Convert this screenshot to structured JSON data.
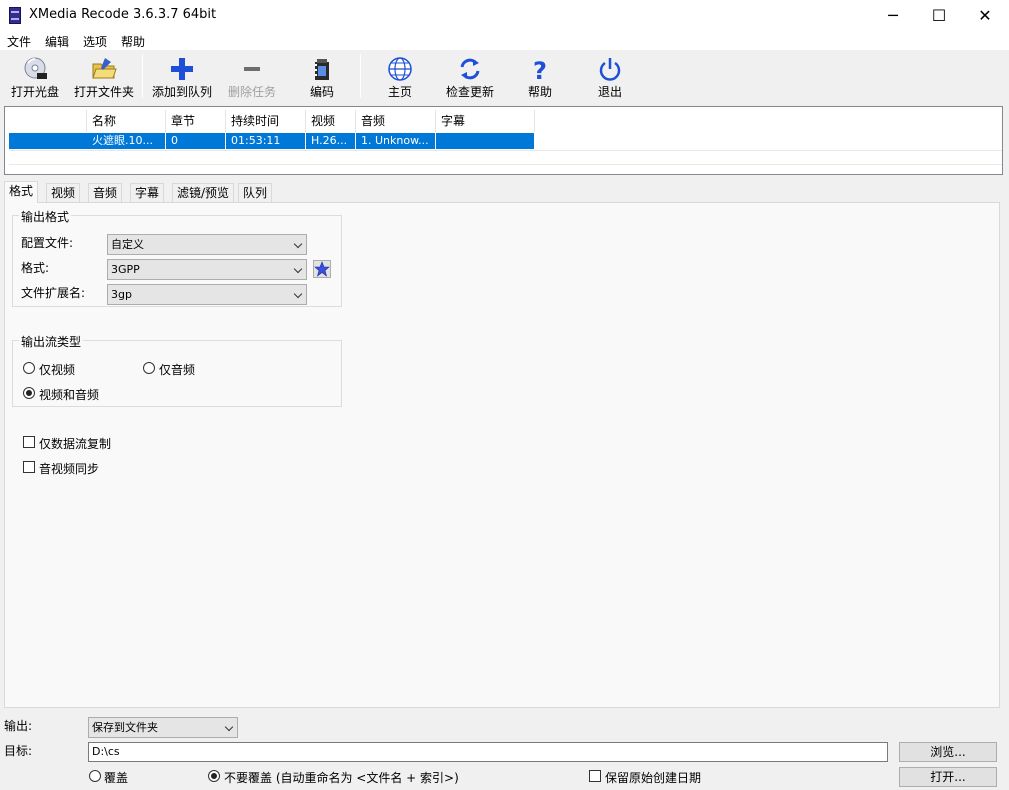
{
  "window": {
    "title": "XMedia Recode 3.6.3.7 64bit",
    "min": "─",
    "max": "☐",
    "close": "✕"
  },
  "menu": [
    "文件",
    "编辑",
    "选项",
    "帮助"
  ],
  "toolbar": {
    "open_disc": "打开光盘",
    "open_folder": "打开文件夹",
    "add_queue": "添加到队列",
    "remove_task": "删除任务",
    "encode": "编码",
    "home": "主页",
    "check_update": "检查更新",
    "help": "帮助",
    "exit": "退出"
  },
  "filelist": {
    "columns": [
      "名称",
      "章节",
      "持续时间",
      "视频",
      "音频",
      "字幕"
    ],
    "rows": [
      {
        "name": "火遮眼.10...",
        "chapter": "0",
        "duration": "01:53:11",
        "video": "H.26...",
        "audio": "1. Unknow...",
        "subtitle": ""
      }
    ]
  },
  "tabs": [
    "格式",
    "视频",
    "音频",
    "字幕",
    "滤镜/预览",
    "队列"
  ],
  "output_format": {
    "title": "输出格式",
    "profile_label": "配置文件:",
    "profile_value": "自定义",
    "format_label": "格式:",
    "format_value": "3GPP",
    "ext_label": "文件扩展名:",
    "ext_value": "3gp"
  },
  "stream_type": {
    "title": "输出流类型",
    "video_only": "仅视频",
    "audio_only": "仅音频",
    "video_audio": "视频和音频",
    "selected": "video_audio"
  },
  "options": {
    "stream_copy": "仅数据流复制",
    "av_sync": "音视频同步"
  },
  "bottom": {
    "output_label": "输出:",
    "output_value": "保存到文件夹",
    "target_label": "目标:",
    "target_value": "D:\\cs",
    "browse": "浏览...",
    "open": "打开...",
    "overwrite": "覆盖",
    "no_overwrite": "不要覆盖 (自动重命名为 <文件名 + 索引>)",
    "keep_date": "保留原始创建日期"
  },
  "colors": {
    "selection": "#0078d7",
    "accent_blue": "#1e4fd8"
  }
}
